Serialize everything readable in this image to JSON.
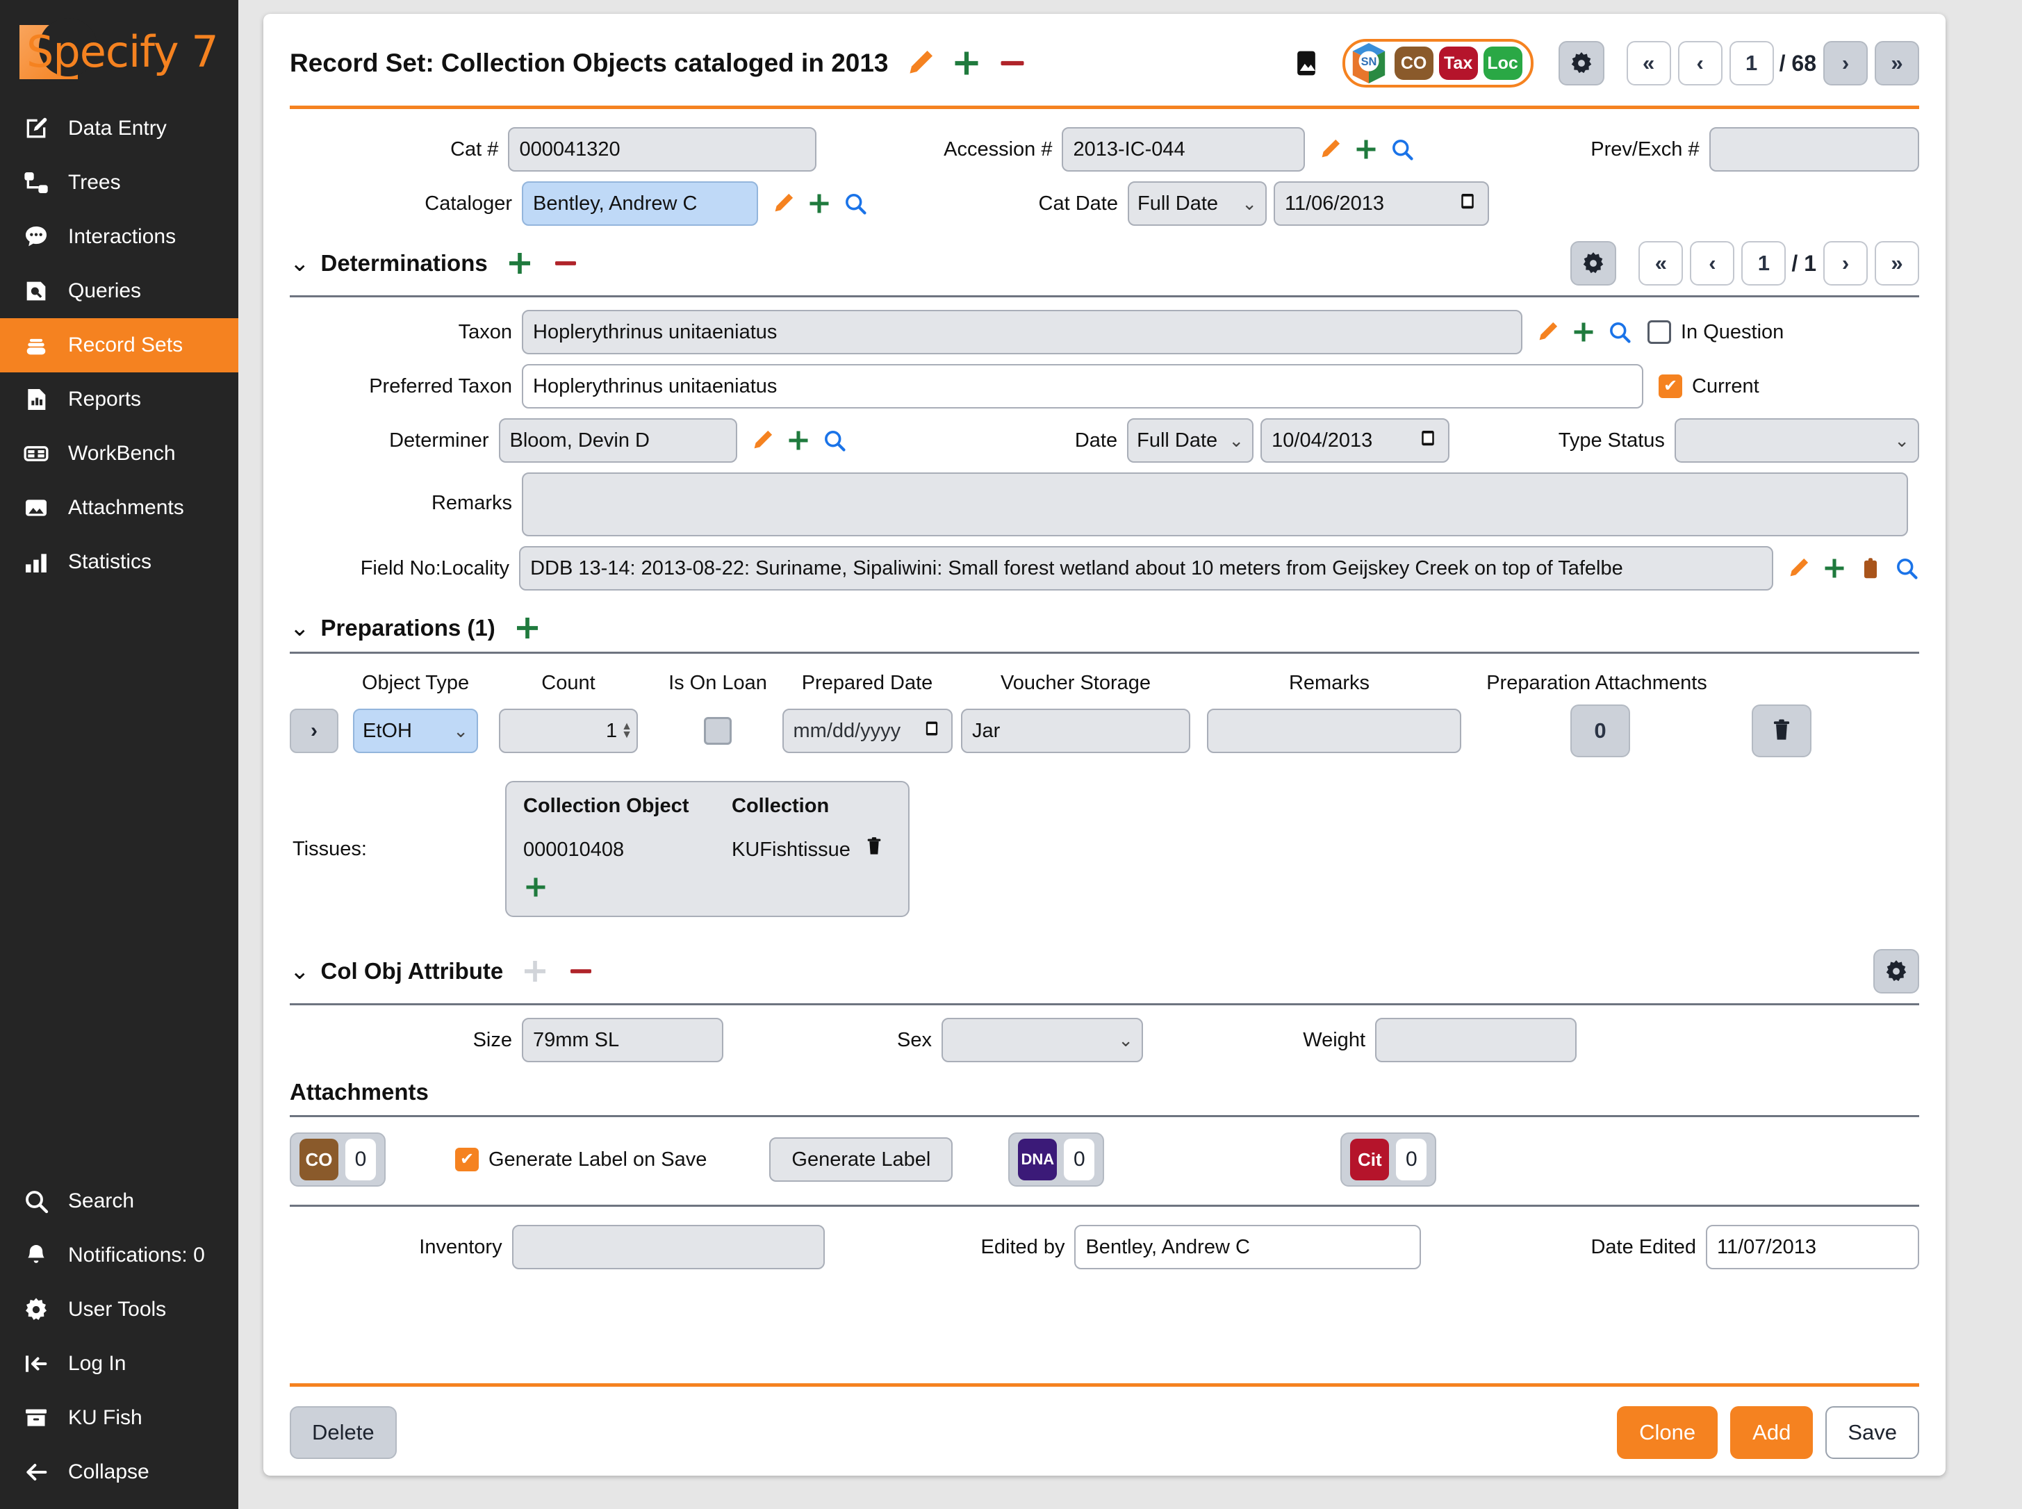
{
  "sidebar": {
    "logo_text": "Specify 7",
    "items": [
      {
        "label": "Data Entry",
        "icon": "edit-square-icon",
        "active": false
      },
      {
        "label": "Trees",
        "icon": "tree-icon",
        "active": false
      },
      {
        "label": "Interactions",
        "icon": "chat-icon",
        "active": false
      },
      {
        "label": "Queries",
        "icon": "query-icon",
        "active": false
      },
      {
        "label": "Record Sets",
        "icon": "record-sets-icon",
        "active": true
      },
      {
        "label": "Reports",
        "icon": "report-icon",
        "active": false
      },
      {
        "label": "WorkBench",
        "icon": "workbench-icon",
        "active": false
      },
      {
        "label": "Attachments",
        "icon": "image-icon",
        "active": false
      },
      {
        "label": "Statistics",
        "icon": "bar-chart-icon",
        "active": false
      }
    ],
    "bottom_items": [
      {
        "label": "Search",
        "icon": "search-icon"
      },
      {
        "label": "Notifications: 0",
        "icon": "bell-icon"
      },
      {
        "label": "User Tools",
        "icon": "gear-icon"
      },
      {
        "label": "Log In",
        "icon": "login-arrow-icon"
      },
      {
        "label": "KU Fish",
        "icon": "archive-box-icon"
      },
      {
        "label": "Collapse",
        "icon": "arrow-left-icon"
      }
    ]
  },
  "header": {
    "title": "Record Set: Collection Objects cataloged in 2013",
    "edit_icon": "pencil-icon",
    "add_icon": "plus-icon",
    "remove_icon": "minus-icon",
    "attachment_view_icon": "image-icon",
    "form_tabs": [
      {
        "label": "SN",
        "name": "specify-network-icon"
      },
      {
        "label": "CO",
        "name": "collection-object-tab"
      },
      {
        "label": "Tax",
        "name": "taxon-tab"
      },
      {
        "label": "Loc",
        "name": "locality-tab"
      }
    ],
    "settings_icon": "gear-icon",
    "nav": {
      "first": "«",
      "prev": "‹",
      "current": "1",
      "total": "/ 68",
      "next": "›",
      "last": "»"
    }
  },
  "top_form": {
    "cat_no_label": "Cat #",
    "cat_no_value": "000041320",
    "cataloger_label": "Cataloger",
    "cataloger_value": "Bentley, Andrew C",
    "accession_label": "Accession #",
    "accession_value": "2013-IC-044",
    "cat_date_label": "Cat Date",
    "cat_date_precision": "Full Date",
    "cat_date_value": "11/06/2013",
    "prev_exch_label": "Prev/Exch #",
    "prev_exch_value": ""
  },
  "determinations": {
    "title": "Determinations",
    "caret": "⌄",
    "nav": {
      "first": "«",
      "prev": "‹",
      "current": "1",
      "total": "/ 1",
      "next": "›",
      "last": "»"
    },
    "taxon_label": "Taxon",
    "taxon_value": "Hoplerythrinus unitaeniatus",
    "in_question_label": "In Question",
    "in_question_checked": false,
    "preferred_taxon_label": "Preferred Taxon",
    "preferred_taxon_value": "Hoplerythrinus unitaeniatus",
    "current_label": "Current",
    "current_checked": true,
    "determiner_label": "Determiner",
    "determiner_value": "Bloom, Devin D",
    "date_label": "Date",
    "date_precision": "Full Date",
    "date_value": "10/04/2013",
    "type_status_label": "Type Status",
    "type_status_value": "",
    "remarks_label": "Remarks",
    "remarks_value": "",
    "field_no_label": "Field No:Locality",
    "field_no_value": "DDB 13-14: 2013-08-22: Suriname, Sipaliwini: Small forest wetland about 10 meters from Geijskey Creek on top of Tafelbe"
  },
  "preparations": {
    "title": "Preparations (1)",
    "caret": "⌄",
    "columns": [
      "Object Type",
      "Count",
      "Is On Loan",
      "Prepared Date",
      "Voucher Storage",
      "Remarks",
      "Preparation Attachments"
    ],
    "rows": [
      {
        "expand": "›",
        "object_type": "EtOH",
        "count": "1",
        "is_on_loan": false,
        "prepared_date_placeholder": "mm/dd/yyyy",
        "prepared_date_value": "",
        "voucher_storage": "Jar",
        "remarks": "",
        "attachments_count": "0",
        "delete_icon": "trash-icon"
      }
    ],
    "tissues_label": "Tissues:",
    "tissues_columns": [
      "Collection Object",
      "Collection"
    ],
    "tissues_rows": [
      {
        "collection_object": "000010408",
        "collection": "KUFishtissue",
        "delete_icon": "trash-icon"
      }
    ],
    "tissues_add_icon": "plus-icon"
  },
  "col_obj_attribute": {
    "title": "Col Obj Attribute",
    "caret": "⌄",
    "size_label": "Size",
    "size_value": "79mm SL",
    "sex_label": "Sex",
    "sex_value": "",
    "weight_label": "Weight",
    "weight_value": "",
    "settings_icon": "gear-icon"
  },
  "attachments": {
    "title": "Attachments",
    "co_label": "CO",
    "co_count": "0",
    "generate_label_on_save": "Generate Label on Save",
    "generate_label_checked": true,
    "generate_label_button": "Generate Label",
    "dna_label": "DNA",
    "dna_count": "0",
    "cit_label": "Cit",
    "cit_count": "0"
  },
  "bottom_form": {
    "inventory_label": "Inventory",
    "inventory_value": "",
    "edited_by_label": "Edited by",
    "edited_by_value": "Bentley, Andrew C",
    "date_edited_label": "Date Edited",
    "date_edited_value": "11/07/2013"
  },
  "footer": {
    "delete_label": "Delete",
    "clone_label": "Clone",
    "add_label": "Add",
    "save_label": "Save"
  },
  "colors": {
    "accent_orange": "#f58220",
    "sidebar_bg": "#252525",
    "field_bg": "#e3e5e9",
    "selected_field": "#bfd9f7",
    "green": "#1f7a3d",
    "red": "#b0242a",
    "blue": "#1a73e8"
  }
}
